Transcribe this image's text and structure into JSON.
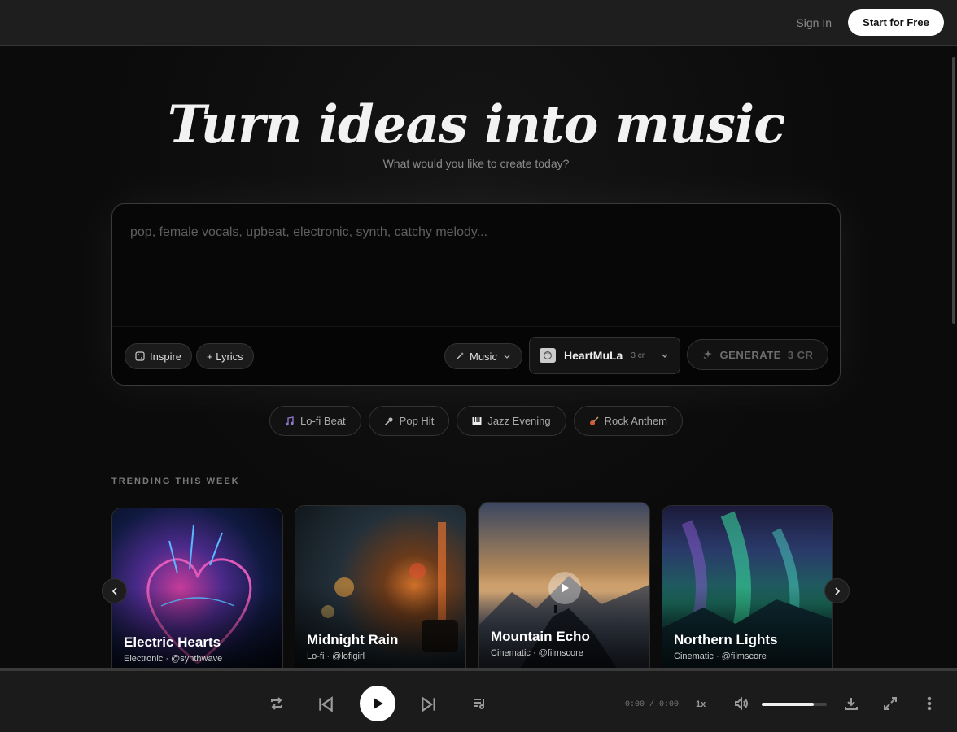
{
  "header": {
    "sign_in": "Sign In",
    "start_free": "Start for Free"
  },
  "hero": {
    "title": "Turn ideas into music",
    "subtitle": "What would you like to create today?"
  },
  "prompt": {
    "placeholder": "pop, female vocals, upbeat, electronic, synth, catchy melody...",
    "inspire": "Inspire",
    "lyrics": "+ Lyrics",
    "mode": "Music",
    "model_name": "HeartMuLa",
    "model_cost": "3 cr",
    "generate": "GENERATE",
    "generate_cost": "3 CR"
  },
  "chips": [
    {
      "label": "Lo-fi Beat",
      "icon": "music-note-icon"
    },
    {
      "label": "Pop Hit",
      "icon": "microphone-icon"
    },
    {
      "label": "Jazz Evening",
      "icon": "piano-icon"
    },
    {
      "label": "Rock Anthem",
      "icon": "guitar-icon"
    }
  ],
  "trending": {
    "label": "TRENDING THIS WEEK",
    "cards": [
      {
        "title": "Electric Hearts",
        "meta": "Electronic · @synthwave"
      },
      {
        "title": "Midnight Rain",
        "meta": "Lo-fi · @lofigirl"
      },
      {
        "title": "Mountain Echo",
        "meta": "Cinematic · @filmscore"
      },
      {
        "title": "Northern Lights",
        "meta": "Cinematic · @filmscore"
      }
    ]
  },
  "player": {
    "time": "0:00 / 0:00",
    "speed": "1x",
    "volume": 0.8
  },
  "colors": {
    "accent": "#ffffff",
    "background": "#0b0b0b"
  }
}
